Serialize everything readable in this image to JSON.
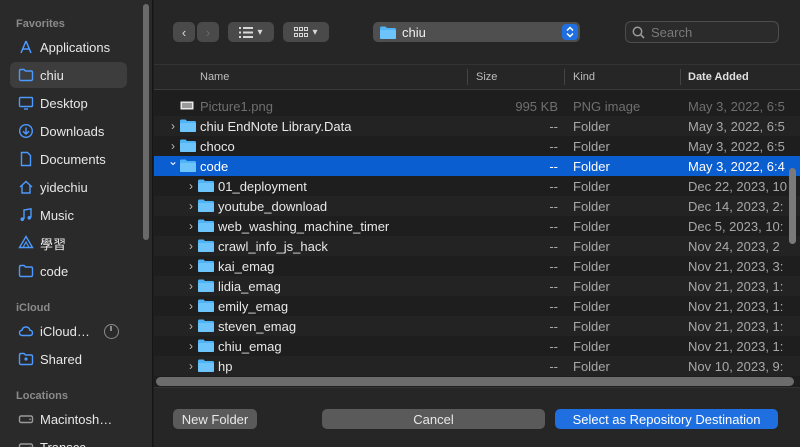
{
  "sidebar": {
    "favorites_title": "Favorites",
    "favorites": [
      {
        "label": "Applications",
        "icon": "applications-icon"
      },
      {
        "label": "chiu",
        "icon": "home-folder-icon",
        "selected": true
      },
      {
        "label": "Desktop",
        "icon": "desktop-icon"
      },
      {
        "label": "Downloads",
        "icon": "downloads-icon"
      },
      {
        "label": "Documents",
        "icon": "documents-icon"
      },
      {
        "label": "yidechiu",
        "icon": "home-icon"
      },
      {
        "label": "Music",
        "icon": "music-icon"
      },
      {
        "label": "學習",
        "icon": "cloud-drive-icon"
      },
      {
        "label": "code",
        "icon": "folder-icon"
      }
    ],
    "icloud_title": "iCloud",
    "icloud": [
      {
        "label": "iCloud…",
        "icon": "icloud-icon"
      },
      {
        "label": "Shared",
        "icon": "shared-folder-icon"
      }
    ],
    "locations_title": "Locations",
    "locations": [
      {
        "label": "Macintosh…",
        "icon": "disk-icon"
      },
      {
        "label": "Transcc…",
        "icon": "disk-icon"
      }
    ]
  },
  "toolbar": {
    "location": "chiu",
    "search_placeholder": "Search"
  },
  "columns": {
    "name": "Name",
    "size": "Size",
    "kind": "Kind",
    "date": "Date Added"
  },
  "rows": [
    {
      "name": "Picture1.png",
      "size": "995 KB",
      "kind": "PNG image",
      "date": "May 3, 2022, 6:5",
      "level": 0,
      "type": "file",
      "dim": true
    },
    {
      "name": "chiu EndNote Library.Data",
      "size": "--",
      "kind": "Folder",
      "date": "May 3, 2022, 6:5",
      "level": 0,
      "type": "folder"
    },
    {
      "name": "choco",
      "size": "--",
      "kind": "Folder",
      "date": "May 3, 2022, 6:5",
      "level": 0,
      "type": "folder"
    },
    {
      "name": "code",
      "size": "--",
      "kind": "Folder",
      "date": "May 3, 2022, 6:4",
      "level": 0,
      "type": "folder",
      "expanded": true,
      "selected": true
    },
    {
      "name": "01_deployment",
      "size": "--",
      "kind": "Folder",
      "date": "Dec 22, 2023, 10",
      "level": 1,
      "type": "folder"
    },
    {
      "name": "youtube_download",
      "size": "--",
      "kind": "Folder",
      "date": "Dec 14, 2023, 2:",
      "level": 1,
      "type": "folder"
    },
    {
      "name": "web_washing_machine_timer",
      "size": "--",
      "kind": "Folder",
      "date": "Dec 5, 2023, 10:",
      "level": 1,
      "type": "folder"
    },
    {
      "name": "crawl_info_js_hack",
      "size": "--",
      "kind": "Folder",
      "date": "Nov 24, 2023, 2",
      "level": 1,
      "type": "folder"
    },
    {
      "name": "kai_emag",
      "size": "--",
      "kind": "Folder",
      "date": "Nov 21, 2023, 3:",
      "level": 1,
      "type": "folder"
    },
    {
      "name": "lidia_emag",
      "size": "--",
      "kind": "Folder",
      "date": "Nov 21, 2023, 1:",
      "level": 1,
      "type": "folder"
    },
    {
      "name": "emily_emag",
      "size": "--",
      "kind": "Folder",
      "date": "Nov 21, 2023, 1:",
      "level": 1,
      "type": "folder"
    },
    {
      "name": "steven_emag",
      "size": "--",
      "kind": "Folder",
      "date": "Nov 21, 2023, 1:",
      "level": 1,
      "type": "folder"
    },
    {
      "name": "chiu_emag",
      "size": "--",
      "kind": "Folder",
      "date": "Nov 21, 2023, 1:",
      "level": 1,
      "type": "folder"
    },
    {
      "name": "hp",
      "size": "--",
      "kind": "Folder",
      "date": "Nov 10, 2023, 9:",
      "level": 1,
      "type": "folder"
    }
  ],
  "buttons": {
    "new_folder": "New Folder",
    "cancel": "Cancel",
    "select": "Select as Repository Destination"
  },
  "colors": {
    "accent": "#0b5ed0",
    "folder": "#4fb3f6"
  }
}
